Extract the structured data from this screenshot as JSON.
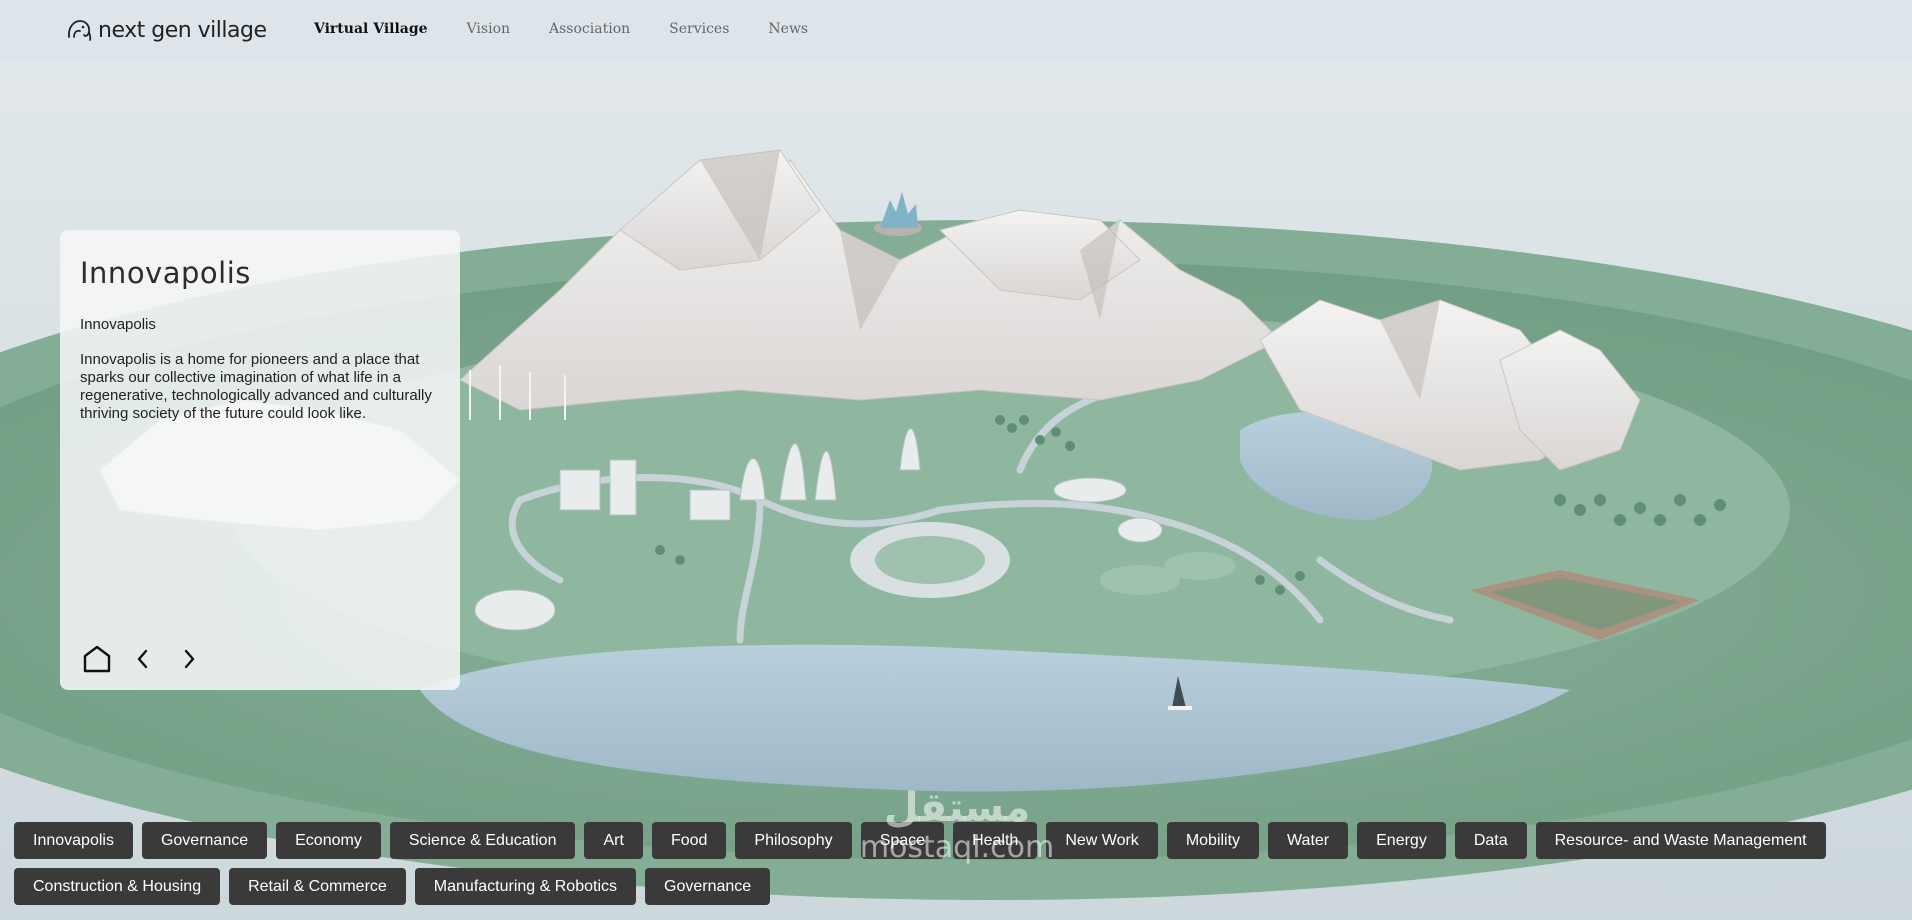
{
  "logo": {
    "text": "next gen village",
    "icon": "elephant-logo-icon"
  },
  "nav": {
    "items": [
      {
        "label": "Virtual Village",
        "active": true
      },
      {
        "label": "Vision",
        "active": false
      },
      {
        "label": "Association",
        "active": false
      },
      {
        "label": "Services",
        "active": false
      },
      {
        "label": "News",
        "active": false
      }
    ]
  },
  "panel": {
    "title": "Innovapolis",
    "subtitle": "Innovapolis",
    "description": "Innovapolis is a home for pioneers and a place that sparks our collective imagination of what life in a regenerative, technologically advanced and culturally thriving society of the future could look like.",
    "controls": {
      "home_icon": "home-icon",
      "prev_icon": "chevron-left-icon",
      "next_icon": "chevron-right-icon"
    }
  },
  "tags": [
    "Innovapolis",
    "Governance",
    "Economy",
    "Science & Education",
    "Art",
    "Food",
    "Philosophy",
    "Space",
    "Health",
    "New Work",
    "Mobility",
    "Water",
    "Energy",
    "Data",
    "Resource- and Waste Management",
    "Construction & Housing",
    "Retail & Commerce",
    "Manufacturing & Robotics",
    "Governance"
  ],
  "watermark": {
    "arabic": "مستقل",
    "latin": "mostaql.com"
  },
  "colors": {
    "ground": "#7fa890",
    "water": "#a8c0cf",
    "mountain": "#e8e6e5",
    "tag_bg": "#3a3a3a",
    "sky": "#dfe5ea"
  }
}
